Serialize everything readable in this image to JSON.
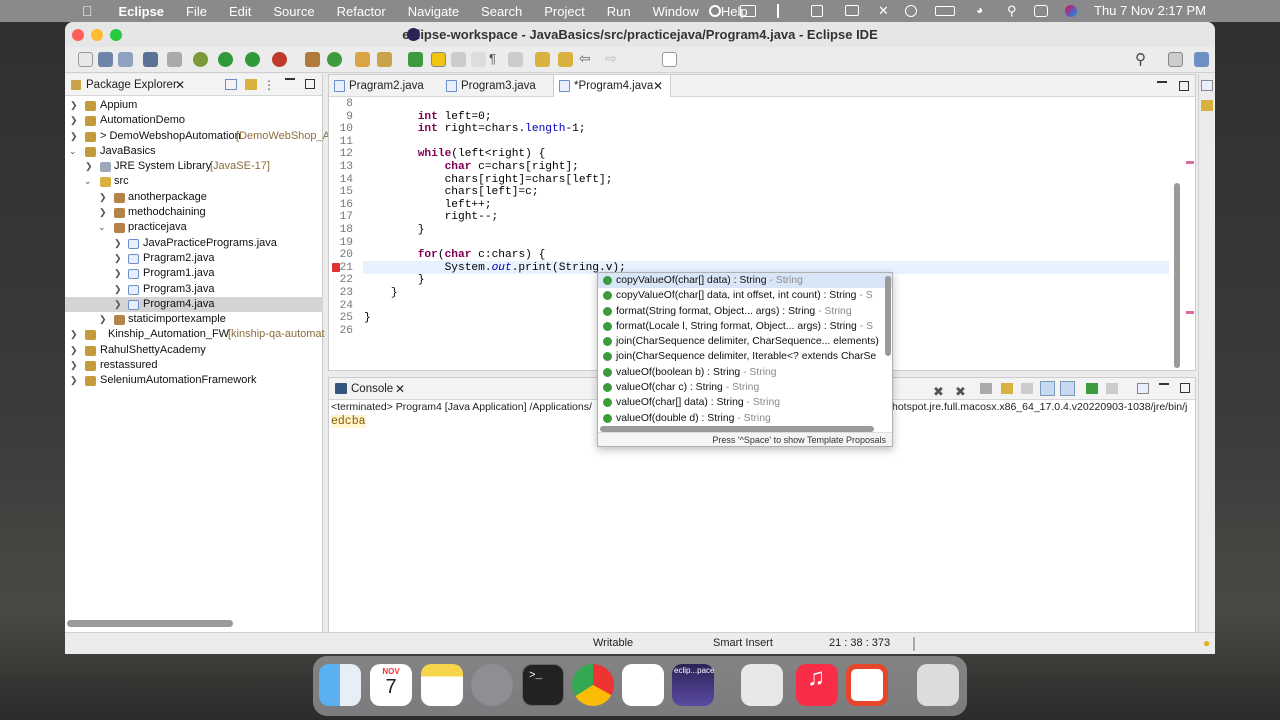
{
  "menubar": {
    "app": "Eclipse",
    "items": [
      "File",
      "Edit",
      "Source",
      "Refactor",
      "Navigate",
      "Search",
      "Project",
      "Run",
      "Window",
      "Help"
    ],
    "clock": "Thu 7 Nov  2:17 PM"
  },
  "window": {
    "title": "eclipse-workspace - JavaBasics/src/practicejava/Program4.java - Eclipse IDE"
  },
  "package_explorer": {
    "title": "Package Explorer",
    "items": [
      {
        "label": "Appium",
        "decoration": ""
      },
      {
        "label": "AutomationDemo",
        "decoration": ""
      },
      {
        "label": "> DemoWebshopAutomation",
        "decoration": "[DemoWebShop_A"
      },
      {
        "label": "JavaBasics",
        "decoration": ""
      },
      {
        "label": "JRE System Library",
        "decoration": "[JavaSE-17]"
      },
      {
        "label": "src",
        "decoration": ""
      },
      {
        "label": "anotherpackage",
        "decoration": ""
      },
      {
        "label": "methodchaining",
        "decoration": ""
      },
      {
        "label": "practicejava",
        "decoration": ""
      },
      {
        "label": "JavaPracticePrograms.java",
        "decoration": ""
      },
      {
        "label": "Pragram2.java",
        "decoration": ""
      },
      {
        "label": "Program1.java",
        "decoration": ""
      },
      {
        "label": "Program3.java",
        "decoration": ""
      },
      {
        "label": "Program4.java",
        "decoration": ""
      },
      {
        "label": "staticimportexample",
        "decoration": ""
      },
      {
        "label": "Kinship_Automation_FW",
        "decoration": "[kinship-qa-automat"
      },
      {
        "label": "RahulShettyAcademy",
        "decoration": ""
      },
      {
        "label": "restassured",
        "decoration": ""
      },
      {
        "label": "SeleniumAutomationFramework",
        "decoration": ""
      }
    ]
  },
  "editor": {
    "tabs": [
      "Pragram2.java",
      "Program3.java",
      "*Program4.java"
    ],
    "line_numbers": [
      "8",
      "9",
      "10",
      "11",
      "12",
      "13",
      "14",
      "15",
      "16",
      "17",
      "18",
      "19",
      "20",
      "21",
      "22",
      "23",
      "24",
      "25",
      "26"
    ]
  },
  "autocomplete": {
    "items": [
      {
        "main": "copyValueOf(char[] data) : String",
        "type": " - String"
      },
      {
        "main": "copyValueOf(char[] data, int offset, int count) : String",
        "type": " - S"
      },
      {
        "main": "format(String format, Object... args) : String",
        "type": " - String"
      },
      {
        "main": "format(Locale l, String format, Object... args) : String",
        "type": " - S"
      },
      {
        "main": "join(CharSequence delimiter, CharSequence... elements)",
        "type": ""
      },
      {
        "main": "join(CharSequence delimiter, Iterable<? extends CharSe",
        "type": ""
      },
      {
        "main": "valueOf(boolean b) : String",
        "type": " - String"
      },
      {
        "main": "valueOf(char c) : String",
        "type": " - String"
      },
      {
        "main": "valueOf(char[] data) : String",
        "type": " - String"
      },
      {
        "main": "valueOf(double d) : String",
        "type": " - String"
      }
    ],
    "footer": "Press '^Space' to show Template Proposals"
  },
  "console": {
    "title": "Console",
    "terminated": "<terminated> Program4 [Java Application] /Applications/",
    "path_tail": "hotspot.jre.full.macosx.x86_64_17.0.4.v20220903-1038/jre/bin/j",
    "output": "edcba"
  },
  "statusbar": {
    "writable": "Writable",
    "insert": "Smart Insert",
    "position": "21 : 38 : 373"
  },
  "dock": {
    "calendar_month": "NOV",
    "calendar_day": "7",
    "eclipse_label": "eclip...pace"
  }
}
